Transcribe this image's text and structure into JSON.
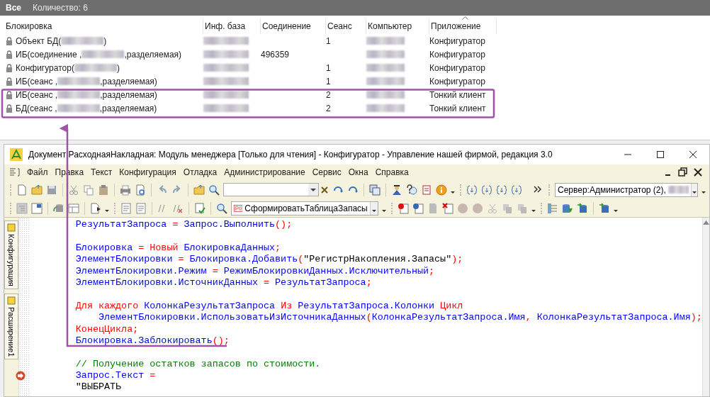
{
  "lock_list": {
    "filter": "Все",
    "count": "Количество: 6",
    "columns": [
      {
        "label": "Блокировка",
        "sorted": false
      },
      {
        "label": "Инф. база",
        "sorted": false
      },
      {
        "label": "Соединение",
        "sorted": false
      },
      {
        "label": "Сеанс",
        "sorted": false
      },
      {
        "label": "Компьютер",
        "sorted": false
      },
      {
        "label": "Приложение",
        "sorted": true
      }
    ],
    "rows": [
      {
        "lock_prefix": "Объект БД(",
        "lock_suffix": ")",
        "session": "1",
        "application": "Конфигуратор"
      },
      {
        "lock_prefix": "ИБ(соединение ,",
        "lock_suffix": ",разделяемая)",
        "connection": "496359",
        "application": "Конфигуратор"
      },
      {
        "lock_prefix": "Конфигуратор(",
        "lock_suffix": ")",
        "session": "1",
        "application": "Конфигуратор"
      },
      {
        "lock_prefix": "ИБ(сеанс ,",
        "lock_suffix": ",разделяемая)",
        "session": "1",
        "application": "Конфигуратор"
      },
      {
        "lock_prefix": "ИБ(сеанс ,",
        "lock_suffix": ",разделяемая)",
        "session": "2",
        "application": "Тонкий клиент"
      },
      {
        "lock_prefix": "БД(сеанс ,",
        "lock_suffix": ",разделяемая)",
        "session": "2",
        "application": "Тонкий клиент"
      }
    ]
  },
  "window": {
    "title": "Документ РасходнаяНакладная: Модуль менеджера [Только для чтения] - Конфигуратор - Управление нашей фирмой, редакция 3.0",
    "menu": [
      "Файл",
      "Правка",
      "Текст",
      "Конфигурация",
      "Отладка",
      "Администрирование",
      "Сервис",
      "Окна",
      "Справка"
    ],
    "server_combo": "Сервер:Администратор (2),",
    "procedure_combo": "СформироватьТаблицаЗапасы",
    "side_tabs": [
      "Конфигурация",
      "Расширение1"
    ],
    "code": [
      {
        "kind": "code",
        "tokens": [
          {
            "kind": "id",
            "text": "РезультатЗапроса"
          },
          {
            "kind": "op",
            "text": " = "
          },
          {
            "kind": "id",
            "text": "Запрос.Выполнить"
          },
          {
            "kind": "op",
            "text": "();"
          }
        ]
      },
      {
        "kind": "blank"
      },
      {
        "kind": "code",
        "tokens": [
          {
            "kind": "id",
            "text": "Блокировка"
          },
          {
            "kind": "op",
            "text": " = "
          },
          {
            "kind": "kw",
            "text": "Новый"
          },
          {
            "kind": "id",
            "text": " БлокировкаДанных"
          },
          {
            "kind": "op",
            "text": ";"
          }
        ]
      },
      {
        "kind": "code",
        "tokens": [
          {
            "kind": "id",
            "text": "ЭлементБлокировки"
          },
          {
            "kind": "op",
            "text": " = "
          },
          {
            "kind": "id",
            "text": "Блокировка.Добавить"
          },
          {
            "kind": "op",
            "text": "("
          },
          {
            "kind": "str",
            "text": "\"РегистрНакопления.Запасы\""
          },
          {
            "kind": "op",
            "text": ");"
          }
        ]
      },
      {
        "kind": "code",
        "tokens": [
          {
            "kind": "id",
            "text": "ЭлементБлокировки.Режим"
          },
          {
            "kind": "op",
            "text": " = "
          },
          {
            "kind": "id",
            "text": "РежимБлокировкиДанных.Исключительный"
          },
          {
            "kind": "op",
            "text": ";"
          }
        ]
      },
      {
        "kind": "code",
        "tokens": [
          {
            "kind": "id",
            "text": "ЭлементБлокировки.ИсточникДанных"
          },
          {
            "kind": "op",
            "text": " = "
          },
          {
            "kind": "id",
            "text": "РезультатЗапроса"
          },
          {
            "kind": "op",
            "text": ";"
          }
        ]
      },
      {
        "kind": "blank"
      },
      {
        "kind": "code",
        "tokens": [
          {
            "kind": "kw",
            "text": "Для каждого"
          },
          {
            "kind": "id",
            "text": " КолонкаРезультатЗапроса "
          },
          {
            "kind": "kw",
            "text": "Из"
          },
          {
            "kind": "id",
            "text": " РезультатЗапроса.Колонки "
          },
          {
            "kind": "kw",
            "text": "Цикл"
          }
        ]
      },
      {
        "kind": "code",
        "tokens": [
          {
            "kind": "id",
            "text": "    ЭлементБлокировки.ИспользоватьИзИсточникаДанных"
          },
          {
            "kind": "op",
            "text": "("
          },
          {
            "kind": "id",
            "text": "КолонкаРезультатЗапроса.Имя"
          },
          {
            "kind": "op",
            "text": ", "
          },
          {
            "kind": "id",
            "text": "КолонкаРезультатЗапроса.Имя"
          },
          {
            "kind": "op",
            "text": ");"
          }
        ]
      },
      {
        "kind": "code",
        "tokens": [
          {
            "kind": "kw",
            "text": "КонецЦикла"
          },
          {
            "kind": "op",
            "text": ";"
          }
        ]
      },
      {
        "kind": "code",
        "tokens": [
          {
            "kind": "id",
            "text": "Блокировка.Заблокировать"
          },
          {
            "kind": "op",
            "text": "();"
          }
        ]
      },
      {
        "kind": "blank"
      },
      {
        "kind": "code",
        "tokens": [
          {
            "kind": "comment",
            "text": "// Получение остатков запасов по стоимости."
          }
        ]
      },
      {
        "kind": "current",
        "tokens": [
          {
            "kind": "id",
            "text": "Запрос.Текст"
          },
          {
            "kind": "op",
            "text": " ="
          }
        ]
      },
      {
        "kind": "code",
        "tokens": [
          {
            "kind": "str",
            "text": "\"ВЫБРАТЬ"
          }
        ]
      }
    ]
  }
}
